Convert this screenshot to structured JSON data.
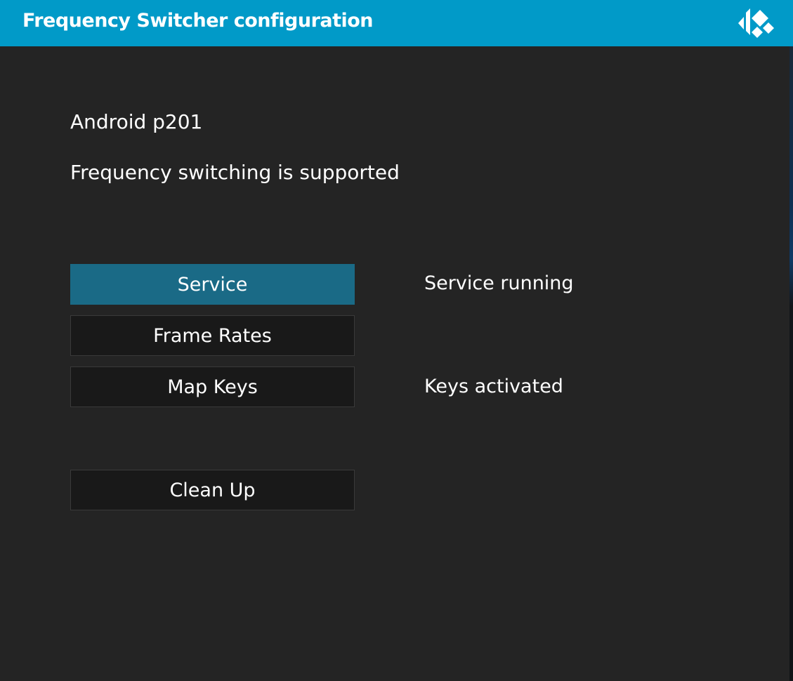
{
  "header": {
    "title": "Frequency Switcher configuration",
    "logo_icon": "kodi-logo-icon",
    "color": "#019ac8"
  },
  "info": {
    "device": "Android p201",
    "support": "Frequency switching is supported"
  },
  "buttons": {
    "service": "Service",
    "frame_rates": "Frame Rates",
    "map_keys": "Map Keys",
    "clean_up": "Clean Up"
  },
  "status": {
    "service": "Service running",
    "keys": "Keys activated"
  },
  "colors": {
    "focused_button": "#1a6a86",
    "dialog_background": "#242424"
  }
}
